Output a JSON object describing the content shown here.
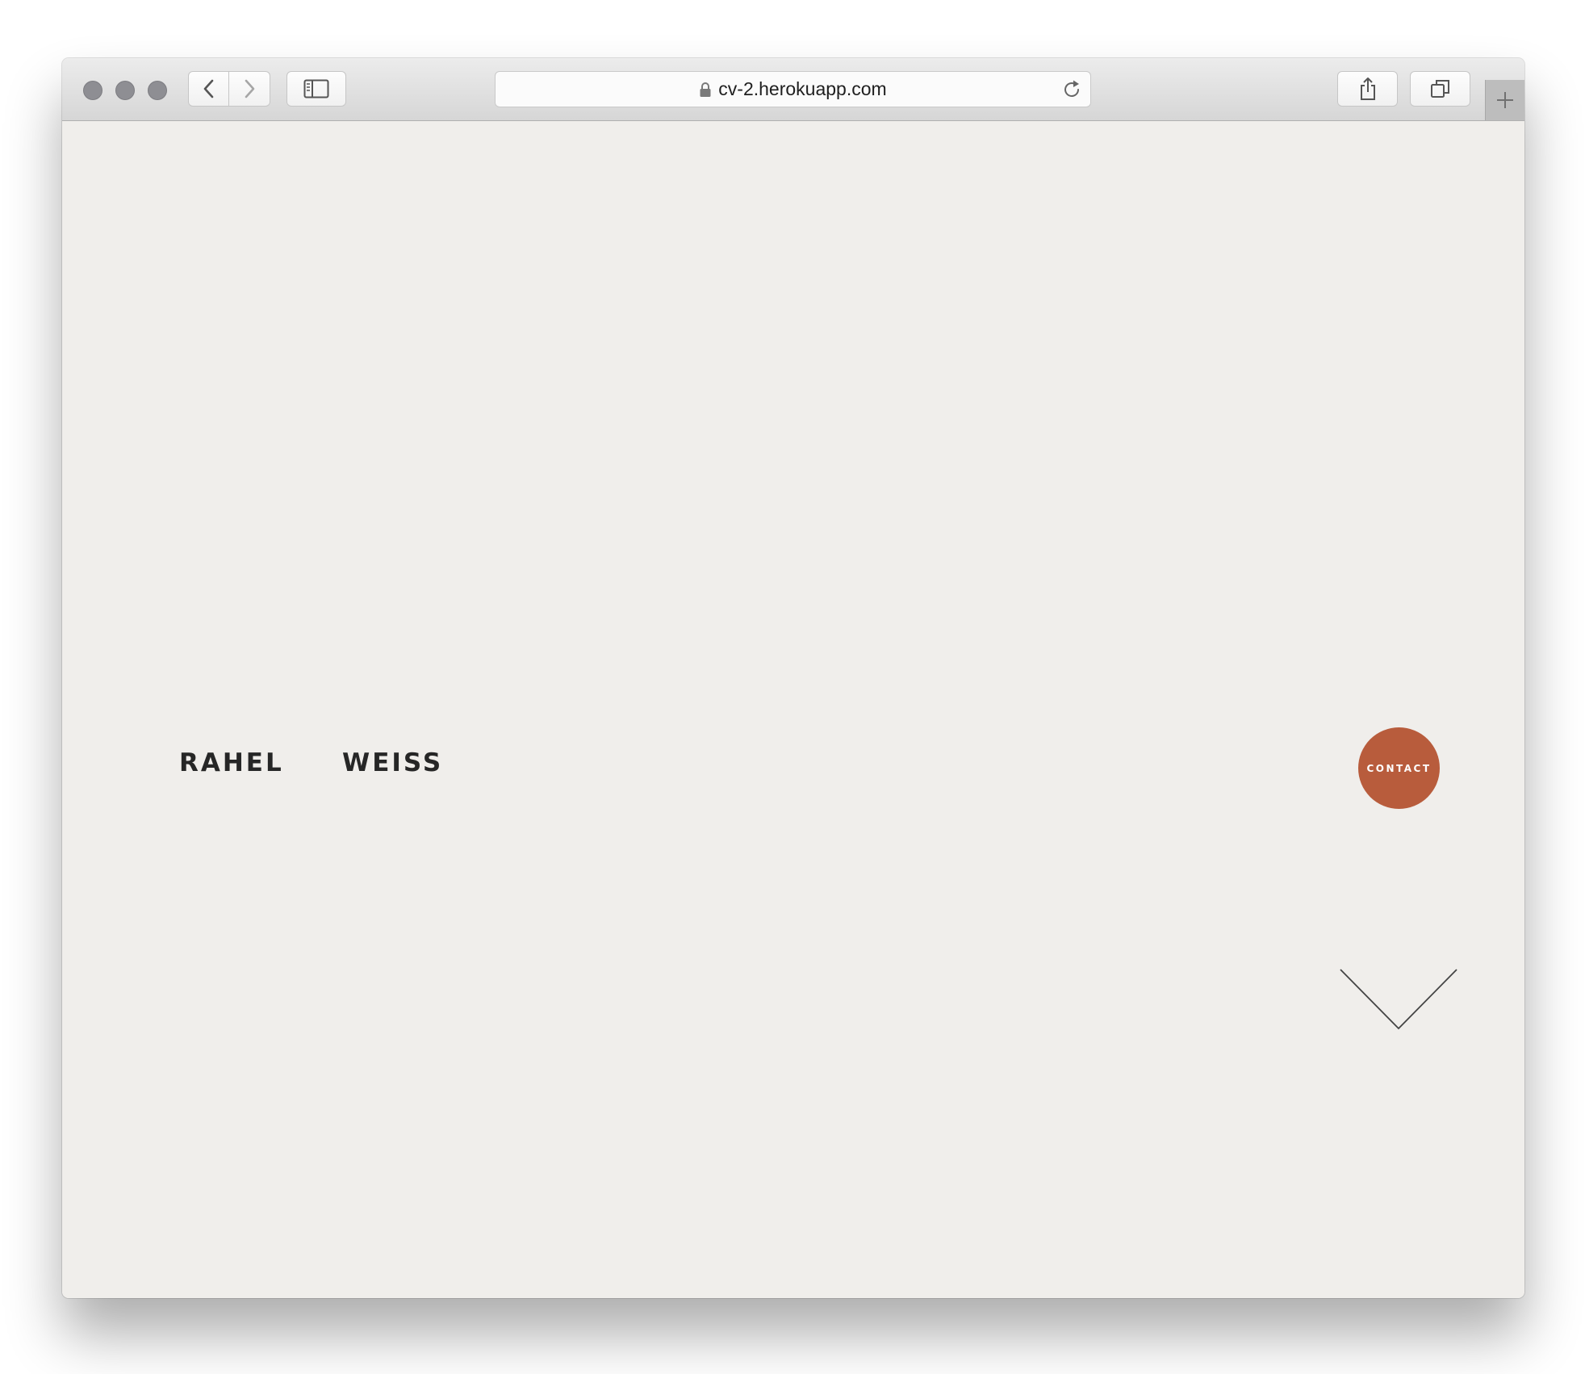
{
  "browser": {
    "url": "cv-2.herokuapp.com",
    "icons": {
      "back": "chevron-left-icon",
      "forward": "chevron-right-icon",
      "sidebar": "sidebar-icon",
      "lock": "lock-icon",
      "reload": "reload-icon",
      "share": "share-icon",
      "tabs": "tabs-icon",
      "new_tab": "plus-icon"
    }
  },
  "page": {
    "first_name": "RAHEL",
    "last_name": "WEISS",
    "contact_label": "CONTACT",
    "scroll_icon": "chevron-down-icon"
  },
  "colors": {
    "page_background": "#f0eeeb",
    "contact_button": "#b85c3c",
    "name_text": "#262626"
  }
}
